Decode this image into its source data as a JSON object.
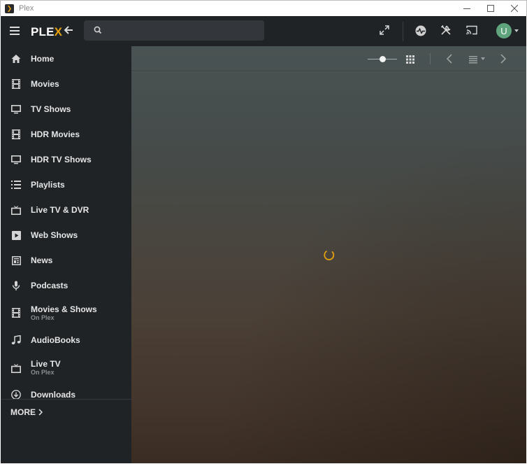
{
  "window": {
    "title": "Plex",
    "controls": [
      "minimize",
      "maximize",
      "close"
    ]
  },
  "topbar": {
    "logo_main": "PLE",
    "logo_accent": "X",
    "search": {
      "value": "",
      "placeholder": ""
    },
    "avatar_initial": "U",
    "icons": [
      "menu-icon",
      "back-arrow-icon",
      "search-icon",
      "fullscreen-icon",
      "activity-icon",
      "settings-tools-icon",
      "cast-icon",
      "chevron-down-icon"
    ]
  },
  "sidebar": {
    "items": [
      {
        "label": "Home",
        "sub": "",
        "icon": "home-icon"
      },
      {
        "label": "Movies",
        "sub": "",
        "icon": "film-icon"
      },
      {
        "label": "TV Shows",
        "sub": "",
        "icon": "monitor-icon"
      },
      {
        "label": "HDR Movies",
        "sub": "",
        "icon": "film-icon"
      },
      {
        "label": "HDR TV Shows",
        "sub": "",
        "icon": "monitor-icon"
      },
      {
        "label": "Playlists",
        "sub": "",
        "icon": "list-icon"
      },
      {
        "label": "Live TV & DVR",
        "sub": "",
        "icon": "tv-icon"
      },
      {
        "label": "Web Shows",
        "sub": "",
        "icon": "play-box-icon"
      },
      {
        "label": "News",
        "sub": "",
        "icon": "newspaper-icon"
      },
      {
        "label": "Podcasts",
        "sub": "",
        "icon": "microphone-icon"
      },
      {
        "label": "Movies & Shows",
        "sub": "On Plex",
        "icon": "film-icon"
      },
      {
        "label": "AudioBooks",
        "sub": "",
        "icon": "music-note-icon"
      },
      {
        "label": "Live TV",
        "sub": "On Plex",
        "icon": "tv-icon"
      },
      {
        "label": "Downloads",
        "sub": "",
        "icon": "download-circle-icon"
      }
    ],
    "more_label": "MORE"
  },
  "main": {
    "poster_size_slider": 0.5,
    "state": "loading",
    "toolbar_icons": [
      "size-slider",
      "grid-view-icon",
      "chevron-left-icon",
      "list-view-icon",
      "chevron-right-icon"
    ]
  },
  "colors": {
    "accent": "#e5a00d",
    "sidebar_bg": "#1f2326",
    "text": "#e6e6e6",
    "avatar": "#5fa47c"
  }
}
